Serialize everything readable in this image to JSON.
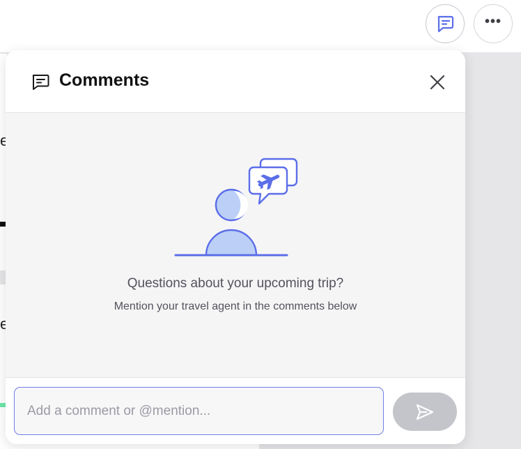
{
  "topbar": {
    "comments_button_icon": "chat-bubble-icon",
    "more_button_label": "•••",
    "more_button_icon": "more-horizontal-icon"
  },
  "background": {
    "peek_text_1": "e",
    "peek_text_2": "e"
  },
  "comments_panel": {
    "title": "Comments",
    "title_icon": "chat-bubble-icon",
    "close_icon": "close-icon",
    "empty_state": {
      "illustration": "person-with-travel-chat-illustration",
      "title": "Questions about your upcoming trip?",
      "subtitle": "Mention your travel agent in the comments below"
    },
    "input": {
      "value": "",
      "placeholder": "Add a comment or @mention..."
    },
    "send_icon": "send-icon"
  },
  "colors": {
    "accent": "#5b6ee8",
    "illustration_fill": "#bcd0f7",
    "input_border": "#6f7fe8",
    "send_disabled": "#c4c5cb",
    "panel_bg": "#f5f5f6"
  }
}
